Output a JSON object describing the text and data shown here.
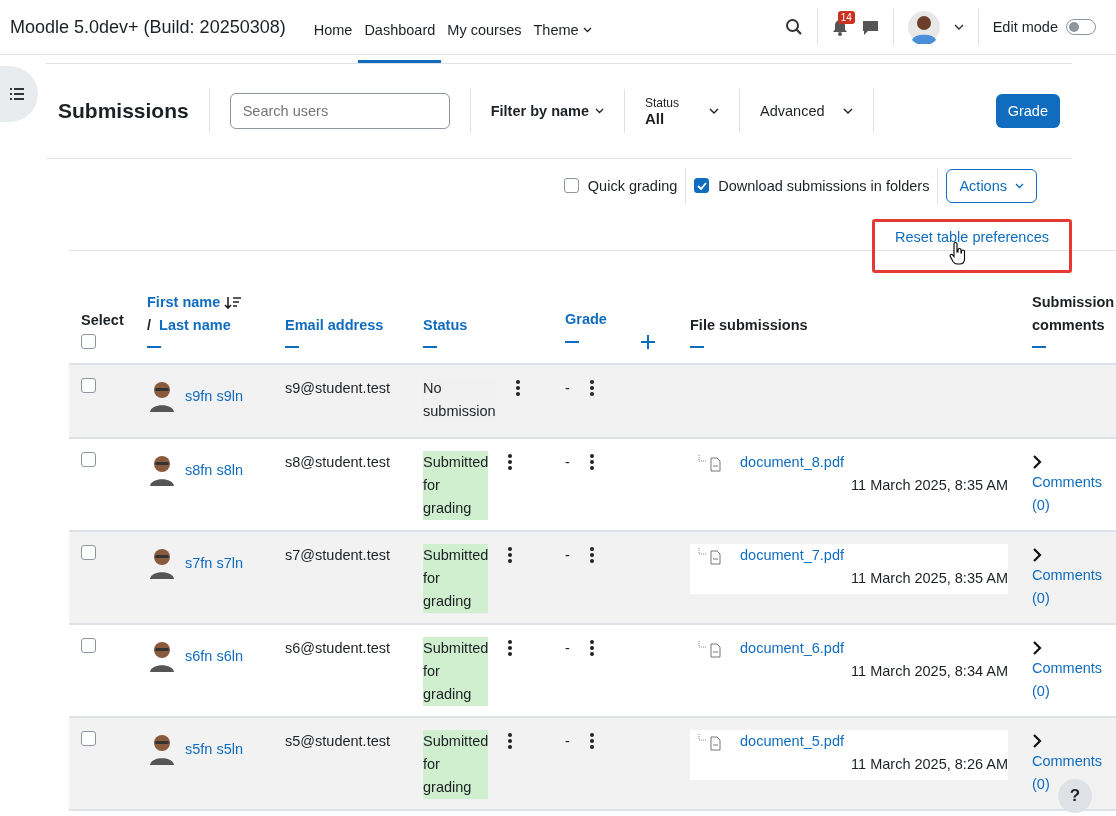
{
  "navbar": {
    "brand": "Moodle 5.0dev+ (Build: 20250308)",
    "nav": [
      {
        "label": "Home",
        "kind": "link",
        "selected": false
      },
      {
        "label": "Dashboard",
        "kind": "link",
        "selected": true
      },
      {
        "label": "My courses",
        "kind": "link",
        "selected": false
      },
      {
        "label": "Theme",
        "kind": "dropdown",
        "selected": false
      }
    ],
    "notification_count": "14",
    "edit_mode": {
      "label": "Edit mode",
      "on": false
    }
  },
  "toolbar": {
    "title": "Submissions",
    "search": {
      "placeholder": "Search users"
    },
    "filter": "Filter by name",
    "status": {
      "label": "Status",
      "value": "All"
    },
    "advanced": "Advanced",
    "grade_button": "Grade"
  },
  "options": {
    "quick_grading": {
      "label": "Quick grading",
      "checked": false
    },
    "download_in_folders": {
      "label": "Download submissions in folders",
      "checked": true
    },
    "actions": "Actions"
  },
  "reset_link": {
    "label": "Reset table preferences",
    "highlighted": true
  },
  "table": {
    "select_all_checked": false,
    "columns": {
      "select": "Select",
      "first_name": "First name",
      "name_separator": "/",
      "last_name": "Last name",
      "email": "Email address",
      "status": "Status",
      "grade": "Grade",
      "files": "File submissions",
      "comments": "Submission comments"
    },
    "rows": [
      {
        "selected": false,
        "name": "s9fn s9ln",
        "email": "s9@student.test",
        "status": {
          "label": "No submission",
          "kind": "none"
        },
        "grade": "-",
        "comments": "",
        "comments_count": ""
      },
      {
        "selected": false,
        "name": "s8fn s8ln",
        "email": "s8@student.test",
        "status": {
          "label": "Submitted for grading",
          "kind": "submitted"
        },
        "grade": "-",
        "file": {
          "name": "document_8.pdf",
          "date": "11 March 2025, 8:35 AM"
        },
        "comments": "Comments",
        "comments_count": "(0)"
      },
      {
        "selected": false,
        "name": "s7fn s7ln",
        "email": "s7@student.test",
        "status": {
          "label": "Submitted for grading",
          "kind": "submitted"
        },
        "grade": "-",
        "file": {
          "name": "document_7.pdf",
          "date": "11 March 2025, 8:35 AM"
        },
        "comments": "Comments",
        "comments_count": "(0)"
      },
      {
        "selected": false,
        "name": "s6fn s6ln",
        "email": "s6@student.test",
        "status": {
          "label": "Submitted for grading",
          "kind": "submitted"
        },
        "grade": "-",
        "file": {
          "name": "document_6.pdf",
          "date": "11 March 2025, 8:34 AM"
        },
        "comments": "Comments",
        "comments_count": "(0)"
      },
      {
        "selected": false,
        "name": "s5fn s5ln",
        "email": "s5@student.test",
        "status": {
          "label": "Submitted for grading",
          "kind": "submitted"
        },
        "grade": "-",
        "file": {
          "name": "document_5.pdf",
          "date": "11 March 2025, 8:26 AM"
        },
        "comments": "Comments",
        "comments_count": "(0)"
      }
    ]
  },
  "help_button": "?"
}
